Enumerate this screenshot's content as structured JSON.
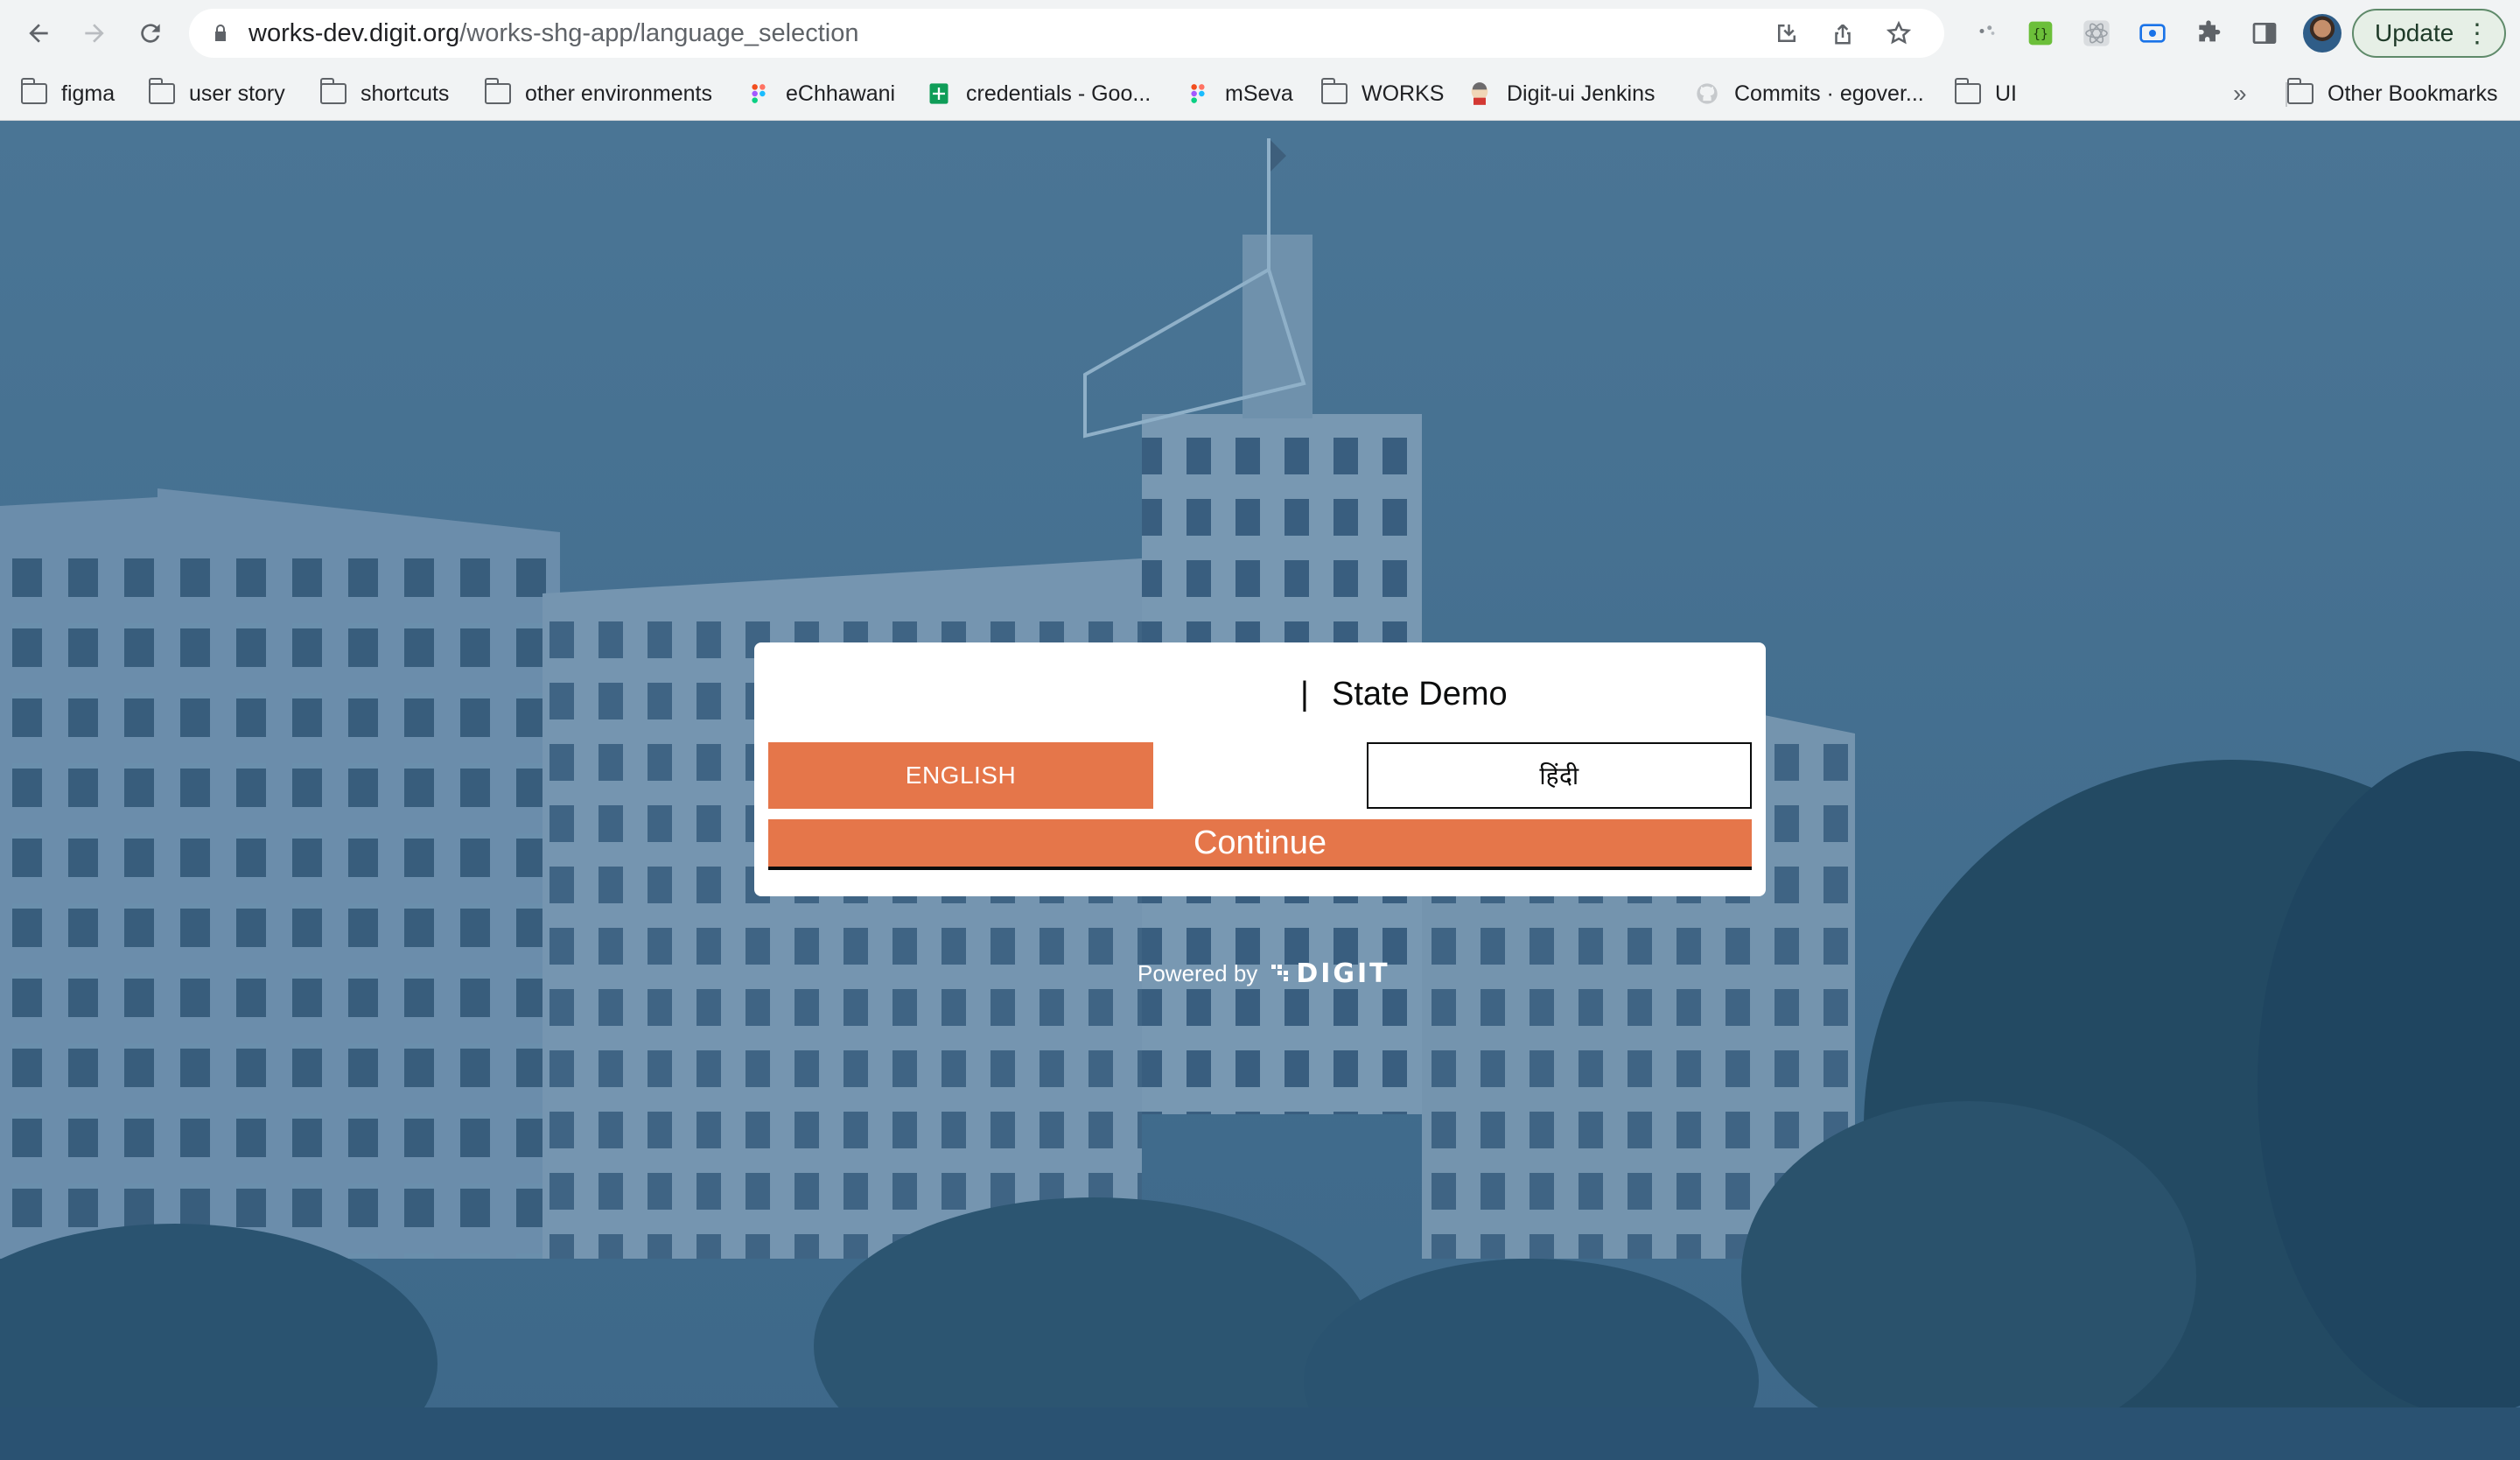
{
  "browser": {
    "url_host": "works-dev.digit.org",
    "url_path": "/works-shg-app/language_selection",
    "update_label": "Update",
    "bookmarks": [
      {
        "label": "figma",
        "icon": "folder-icon"
      },
      {
        "label": "user story",
        "icon": "folder-icon"
      },
      {
        "label": "shortcuts",
        "icon": "folder-icon"
      },
      {
        "label": "other environments",
        "icon": "folder-icon"
      },
      {
        "label": "eChhawani",
        "icon": "figma-icon"
      },
      {
        "label": "credentials - Goo...",
        "icon": "sheets-icon"
      },
      {
        "label": "mSeva",
        "icon": "figma-icon"
      },
      {
        "label": "WORKS",
        "icon": "folder-icon"
      },
      {
        "label": "Digit-ui Jenkins",
        "icon": "jenkins-icon"
      },
      {
        "label": "Commits · egover...",
        "icon": "github-icon"
      },
      {
        "label": "UI",
        "icon": "folder-icon"
      }
    ],
    "more_bookmarks": "»",
    "other_bookmarks": "Other Bookmarks"
  },
  "page": {
    "separator": "|",
    "state_name": "State Demo",
    "languages": [
      {
        "label": "ENGLISH",
        "selected": true
      },
      {
        "label": "हिंदी",
        "selected": false
      }
    ],
    "continue_label": "Continue",
    "powered_by": "Powered by",
    "brand": "DIGIT"
  },
  "colors": {
    "primary": "#e5764a",
    "overlay": "#3f6a8b",
    "text": "#0b0c0c"
  }
}
